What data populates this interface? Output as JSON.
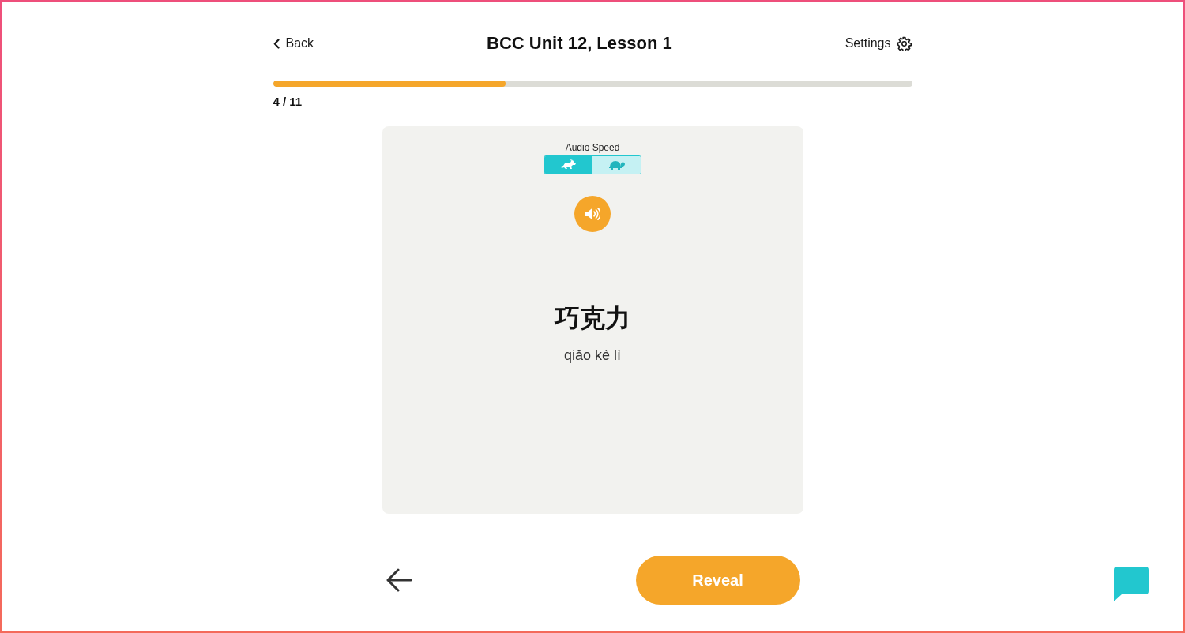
{
  "header": {
    "back": "Back",
    "title": "BCC Unit 12, Lesson 1",
    "settings": "Settings"
  },
  "progress": {
    "level": 0.364,
    "counter": "4 / 11"
  },
  "card": {
    "audio_speed": {
      "label": "Audio Speed",
      "options": [
        {
          "kind": "fast",
          "selected": true
        },
        {
          "kind": "slow",
          "selected": false
        }
      ]
    },
    "hanzi": "巧克力",
    "pinyin": "qiǎo kè lì"
  },
  "footer": {
    "reveal": "Reveal"
  }
}
